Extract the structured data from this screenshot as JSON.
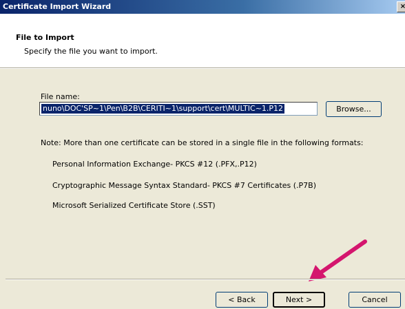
{
  "window": {
    "title": "Certificate Import Wizard",
    "close_label": "×"
  },
  "header": {
    "title": "File to Import",
    "subtitle": "Specify the file you want to import."
  },
  "form": {
    "file_label": "File name:",
    "file_value": "nuno\\DOC'SP~1\\Pen\\B2B\\CERITI~1\\support\\cert\\MULTIC~1.P12",
    "browse_label": "Browse..."
  },
  "note": "Note:  More than one certificate can be stored in a single file in the following formats:",
  "formats": [
    "Personal Information Exchange- PKCS #12 (.PFX,.P12)",
    "Cryptographic Message Syntax Standard- PKCS #7 Certificates (.P7B)",
    "Microsoft Serialized Certificate Store (.SST)"
  ],
  "footer": {
    "back_label": "< Back",
    "next_label": "Next >",
    "cancel_label": "Cancel"
  },
  "colors": {
    "arrow": "#d4166e",
    "title_bar": "#0a246a",
    "selection": "#0a246a"
  }
}
